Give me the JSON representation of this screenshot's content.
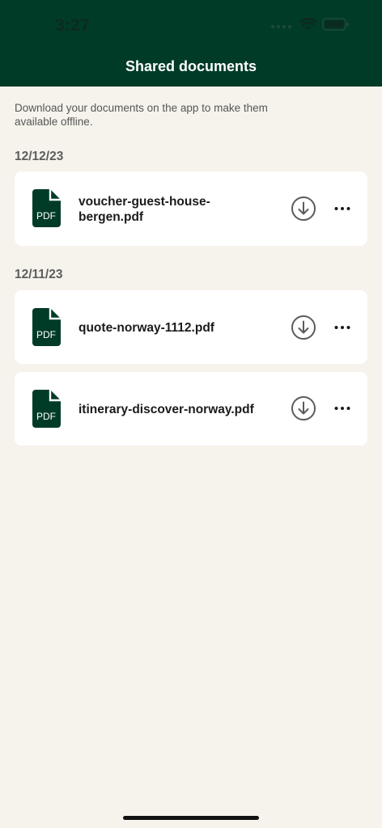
{
  "status_bar": {
    "time": "3:27",
    "icons": [
      "cellular-signal-icon",
      "wifi-icon",
      "battery-icon"
    ]
  },
  "header": {
    "title": "Shared documents"
  },
  "intro_text": "Download your documents on the app to make them available offline.",
  "groups": [
    {
      "date": "12/12/23",
      "documents": [
        {
          "name": "voucher-guest-house-bergen.pdf",
          "icon_label": "PDF"
        }
      ]
    },
    {
      "date": "12/11/23",
      "documents": [
        {
          "name": "quote-norway-1112.pdf",
          "icon_label": "PDF"
        },
        {
          "name": "itinerary-discover-norway.pdf",
          "icon_label": "PDF"
        }
      ]
    }
  ],
  "colors": {
    "header_bg": "#003b28",
    "page_bg": "#f6f3ec",
    "card_bg": "#ffffff",
    "icon_fill": "#003b28",
    "button_gray": "#5b5b5b"
  }
}
